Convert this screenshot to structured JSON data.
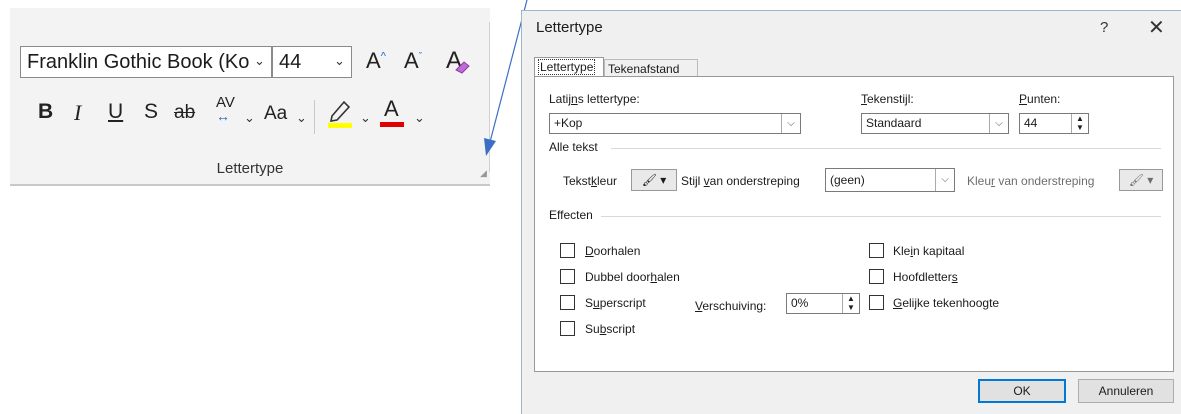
{
  "ribbon": {
    "font_name": "Franklin Gothic Book (Ko",
    "font_size": "44",
    "grow_glyph": "A",
    "shrink_glyph": "A",
    "bold": "B",
    "italic": "I",
    "underline": "U",
    "shadow": "S",
    "strike": "ab",
    "spacing": "AV",
    "change_case": "Aa",
    "font_color_glyph": "A",
    "group_label": "Lettertype",
    "highlight_color": "#ffff00",
    "font_color": "#e00000"
  },
  "dialog": {
    "title": "Lettertype",
    "help": "?",
    "close": "✕",
    "tabs": [
      "Lettertype",
      "Tekenafstand"
    ],
    "latin_font_label_pre": "Latij",
    "latin_font_label_u": "n",
    "latin_font_label_post": "s lettertype:",
    "latin_font_value": "+Kop",
    "style_label_u": "T",
    "style_label_post": "ekenstijl:",
    "style_value": "Standaard",
    "size_label_u": "P",
    "size_label_post": "unten:",
    "size_value": "44",
    "all_text_section": "Alle tekst",
    "text_color_label_pre": "Tekst",
    "text_color_label_u": "k",
    "text_color_label_post": "leur",
    "underline_style_label_pre": "Stijl ",
    "underline_style_label_u": "v",
    "underline_style_label_post": "an onderstreping",
    "underline_style_value": "(geen)",
    "underline_color_label_pre": "Kleu",
    "underline_color_label_u": "r",
    "underline_color_label_post": " van onderstreping",
    "effects_section": "Effecten",
    "effects_left": [
      {
        "pre": "",
        "u": "D",
        "post": "oorhalen"
      },
      {
        "pre": "Dubbel door",
        "u": "h",
        "post": "alen"
      },
      {
        "pre": "S",
        "u": "u",
        "post": "perscript"
      },
      {
        "pre": "Su",
        "u": "b",
        "post": "script"
      }
    ],
    "effects_right": [
      {
        "pre": "Kle",
        "u": "i",
        "post": "n kapitaal"
      },
      {
        "pre": "Hoofdletter",
        "u": "s",
        "post": ""
      },
      {
        "pre": "",
        "u": "G",
        "post": "elijke tekenhoogte"
      }
    ],
    "offset_label_u": "V",
    "offset_label_post": "erschuiving:",
    "offset_value": "0%",
    "ok": "OK",
    "cancel": "Annuleren",
    "accent_color": "#0078d7"
  }
}
